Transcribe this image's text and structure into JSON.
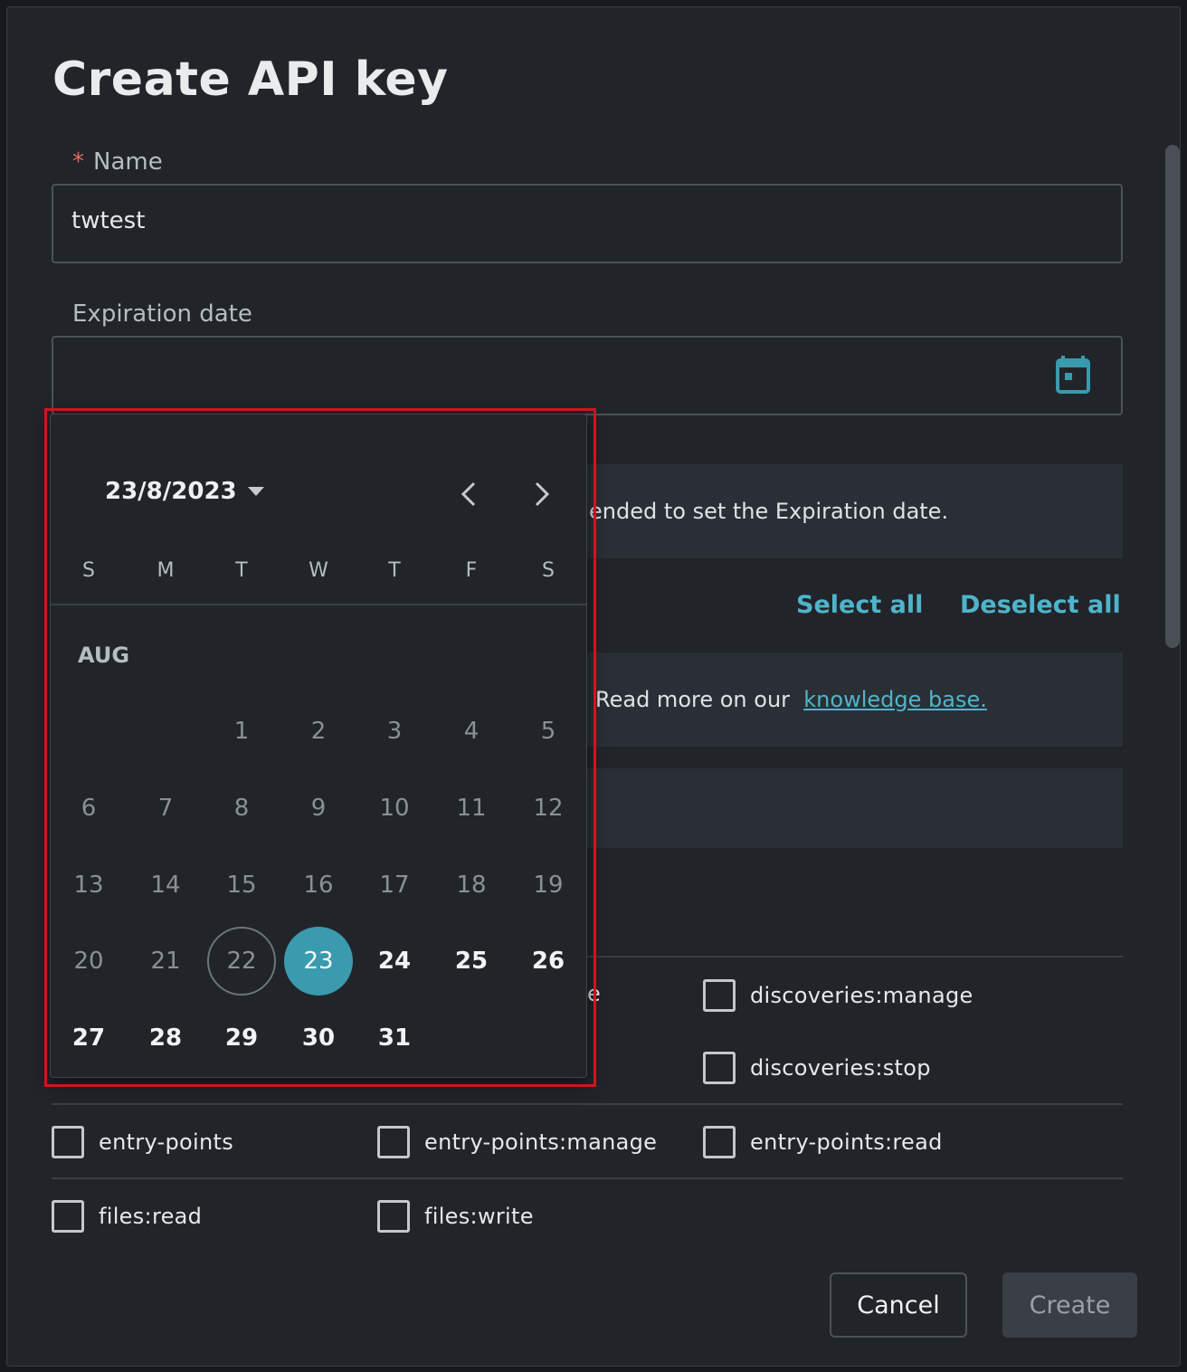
{
  "dialog": {
    "title": "Create API key",
    "name": {
      "required_mark": "*",
      "label": "Name",
      "value": "twtest"
    },
    "expiration": {
      "label": "Expiration date",
      "value": ""
    },
    "notice_text": "ended to set the Expiration date.",
    "select_all": "Select all",
    "deselect_all": "Deselect all",
    "kb_text": "Read more on our",
    "kb_link": "knowledge base.",
    "partial_label": "e",
    "permissions": {
      "discoveries_manage": "discoveries:manage",
      "discoveries_stop": "discoveries:stop",
      "entry_points": "entry-points",
      "entry_points_manage": "entry-points:manage",
      "entry_points_read": "entry-points:read",
      "files_read": "files:read",
      "files_write": "files:write"
    },
    "cancel": "Cancel",
    "create": "Create"
  },
  "date_picker": {
    "current": "23/8/2023",
    "weekdays": [
      "S",
      "M",
      "T",
      "W",
      "T",
      "F",
      "S"
    ],
    "month": "AUG",
    "today": "22",
    "selected": "23",
    "days": [
      "1",
      "2",
      "3",
      "4",
      "5",
      "6",
      "7",
      "8",
      "9",
      "10",
      "11",
      "12",
      "13",
      "14",
      "15",
      "16",
      "17",
      "18",
      "19",
      "20",
      "21",
      "22",
      "23",
      "24",
      "25",
      "26",
      "27",
      "28",
      "29",
      "30",
      "31"
    ]
  },
  "colors": {
    "accent": "#3a9aae",
    "link": "#4fb4cb",
    "highlight": "#d0141c"
  }
}
